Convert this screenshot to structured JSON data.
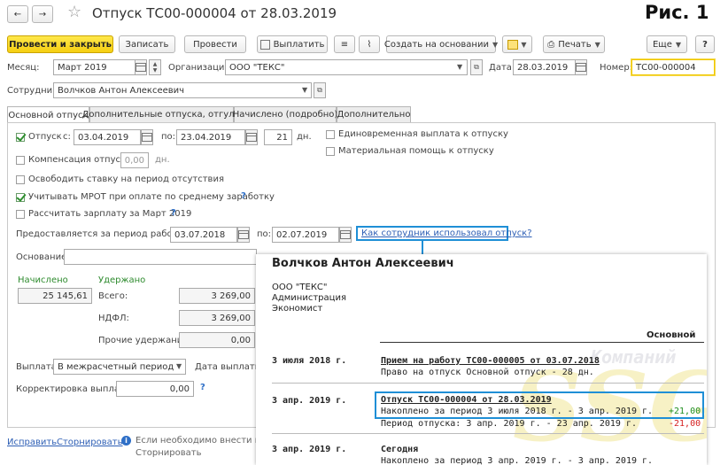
{
  "window": {
    "title": "Отпуск ТС00-000004 от 28.03.2019",
    "figure_label": "Рис. 1"
  },
  "toolbar": {
    "post_close": "Провести и закрыть",
    "write": "Записать",
    "post": "Провести",
    "pay": "Выплатить",
    "create_based": "Создать на основании",
    "print": "Печать",
    "more": "Еще",
    "help": "?"
  },
  "header": {
    "month_label": "Месяц:",
    "month_value": "Март 2019",
    "org_label": "Организация:",
    "org_value": "ООО \"ТЕКС\"",
    "date_label": "Дата:",
    "date_value": "28.03.2019",
    "number_label": "Номер:",
    "number_value": "ТС00-000004",
    "employee_label": "Сотрудник:",
    "employee_value": "Волчков Антон Алексеевич"
  },
  "tabs": [
    "Основной отпуск",
    "Дополнительные отпуска, отгулы",
    "Начислено (подробно)",
    "Дополнительно"
  ],
  "main": {
    "vacation_label": "Отпуск",
    "from_label": "с:",
    "from_value": "03.04.2019",
    "to_label": "по:",
    "to_value": "23.04.2019",
    "days_value": "21",
    "days_label": "дн.",
    "one_time_payment": "Единовременная выплата к отпуску",
    "material_aid": "Материальная помощь к отпуску",
    "compensation_label": "Компенсация отпуска",
    "compensation_value": "0,00",
    "compensation_unit": "дн.",
    "free_rate": "Освободить ставку на период отсутствия",
    "mrot": "Учитывать МРОТ при оплате по среднему заработку",
    "calc_salary": "Рассчитать зарплату за Март 2019",
    "period_label": "Предоставляется за период работы с:",
    "period_from": "03.07.2018",
    "period_to_label": "по:",
    "period_to": "02.07.2019",
    "how_used_link": "Как сотрудник использовал отпуск?",
    "basis_label": "Основание:",
    "accrued_label": "Начислено",
    "accrued_value": "25 145,61",
    "withheld_label": "Удержано",
    "total_label": "Всего:",
    "total_value": "3 269,00",
    "ndfl_label": "НДФЛ:",
    "ndfl_value": "3 269,00",
    "other_label": "Прочие удержания:",
    "other_value": "0,00",
    "payment_label": "Выплата:",
    "payment_value": "В межрасчетный период",
    "payment_dates_label": "Дата выплаты:",
    "correction_label": "Корректировка выплаты:",
    "correction_value": "0,00"
  },
  "footer": {
    "fix_link": "Исправить",
    "reverse_link": "Сторнировать",
    "info_text_1": "Если необходимо внести испр",
    "info_text_2": "Сторнировать"
  },
  "report": {
    "name": "Волчков Антон Алексеевич",
    "org": "ООО \"ТЕКС\"",
    "dept": "Администрация",
    "position": "Экономист",
    "column": "Основной",
    "rows": [
      {
        "date": "3 июля 2018 г.",
        "title": "Прием на работу ТС00-000005 от 03.07.2018",
        "line1": "Право на отпуск Основной отпуск - 28 дн.",
        "v1": "",
        "line2": "",
        "v2": ""
      },
      {
        "date": "3 апр. 2019 г.",
        "title": "Отпуск ТС00-000004 от 28.03.2019",
        "line1": "Накоплено за период 3 июля 2018 г. - 3 апр. 2019 г.",
        "v1": "+21,00",
        "line2": "Период отпуска: 3 апр. 2019 г. - 23 апр. 2019 г.",
        "v2": "-21,00"
      },
      {
        "date": "3 апр. 2019 г.",
        "title": "Сегодня",
        "line1": "Накоплено за период 3 апр. 2019 г. - 3 апр. 2019 г.",
        "v1": "",
        "line2": "",
        "v2": ""
      }
    ],
    "watermark_top": "Компаний",
    "watermark_big": "SSG"
  },
  "colors": {
    "primary_button": "#f5cf12",
    "link": "#2e5fb5",
    "highlight_border": "#1f8fd6",
    "positive": "#1f8f1f",
    "negative": "#d62222"
  }
}
